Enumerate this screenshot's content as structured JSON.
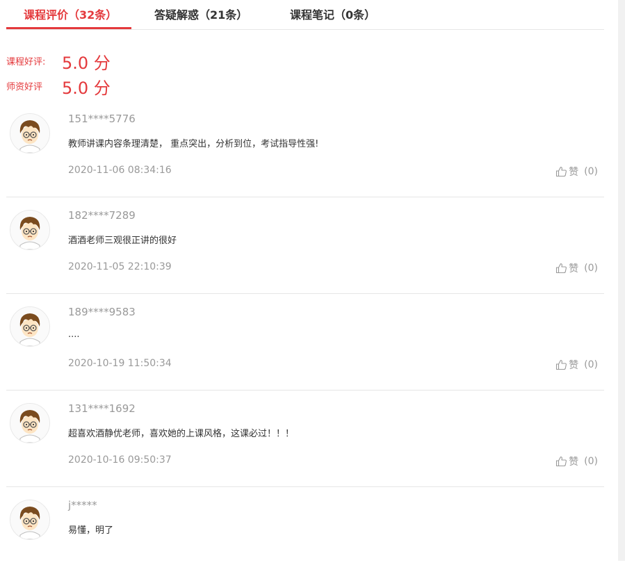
{
  "tabs": [
    {
      "label": "课程评价（32条）",
      "active": true
    },
    {
      "label": "答疑解惑（21条）",
      "active": false
    },
    {
      "label": "课程笔记（0条）",
      "active": false
    }
  ],
  "ratings": [
    {
      "label": "课程好评:",
      "value": "5.0 分"
    },
    {
      "label": "师资好评",
      "value": "5.0 分"
    }
  ],
  "reviews": [
    {
      "username": "151****5776",
      "comment": "教师讲课内容条理清楚， 重点突出，分析到位，考试指导性强!",
      "time": "2020-11-06 08:34:16",
      "like_label": "赞",
      "like_count": "(0)"
    },
    {
      "username": "182****7289",
      "comment": "酒酒老师三观很正讲的很好",
      "time": "2020-11-05 22:10:39",
      "like_label": "赞",
      "like_count": "(0)"
    },
    {
      "username": "189****9583",
      "comment": "....",
      "time": "2020-10-19 11:50:34",
      "like_label": "赞",
      "like_count": "(0)"
    },
    {
      "username": "131****1692",
      "comment": "超喜欢酒静优老师，喜欢她的上课风格，这课必过！！！",
      "time": "2020-10-16 09:50:37",
      "like_label": "赞",
      "like_count": "(0)"
    },
    {
      "username": "j*****",
      "comment": "易懂，明了"
    }
  ],
  "colors": {
    "accent": "#e4393c",
    "muted": "#999999",
    "divider": "#e6e6e6"
  },
  "icons": {
    "avatar": "cartoon-boy-avatar",
    "like": "thumbs-up-icon"
  }
}
